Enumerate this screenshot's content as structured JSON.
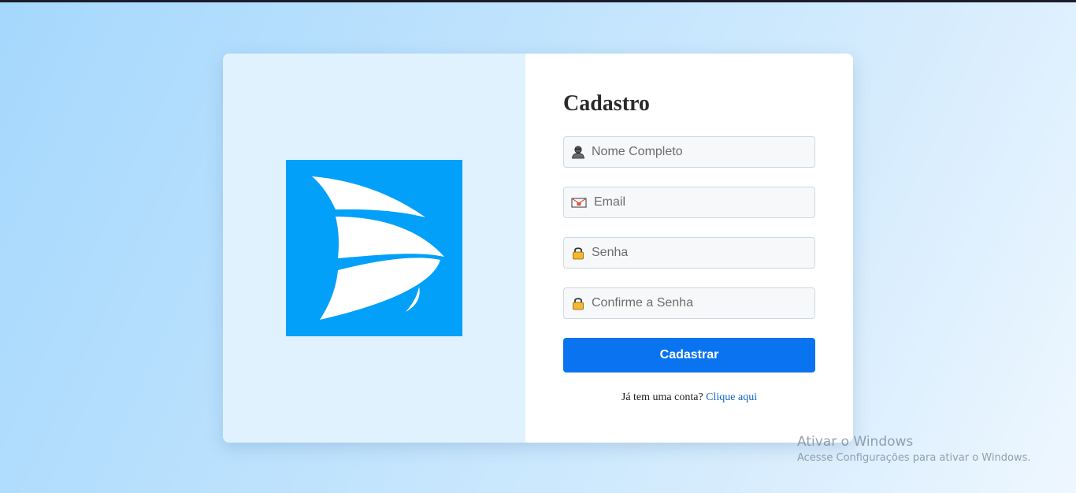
{
  "form": {
    "title": "Cadastro",
    "fields": [
      {
        "placeholder": "Nome Completo",
        "icon": "user-silhouette-icon",
        "value": ""
      },
      {
        "placeholder": "Email",
        "icon": "envelope-icon",
        "value": ""
      },
      {
        "placeholder": "Senha",
        "icon": "padlock-icon",
        "value": ""
      },
      {
        "placeholder": "Confirme a Senha",
        "icon": "padlock-icon",
        "value": ""
      }
    ],
    "submit_label": "Cadastrar",
    "login_prompt": "Já tem uma conta?",
    "login_link": "Clique aqui"
  },
  "watermark": {
    "title": "Ativar o Windows",
    "subtitle": "Acesse Configurações para ativar o Windows."
  },
  "colors": {
    "primary_button": "#0a74f0",
    "logo_background": "#02a0f9",
    "left_panel": "#dff2fe",
    "link": "#1466c4"
  }
}
